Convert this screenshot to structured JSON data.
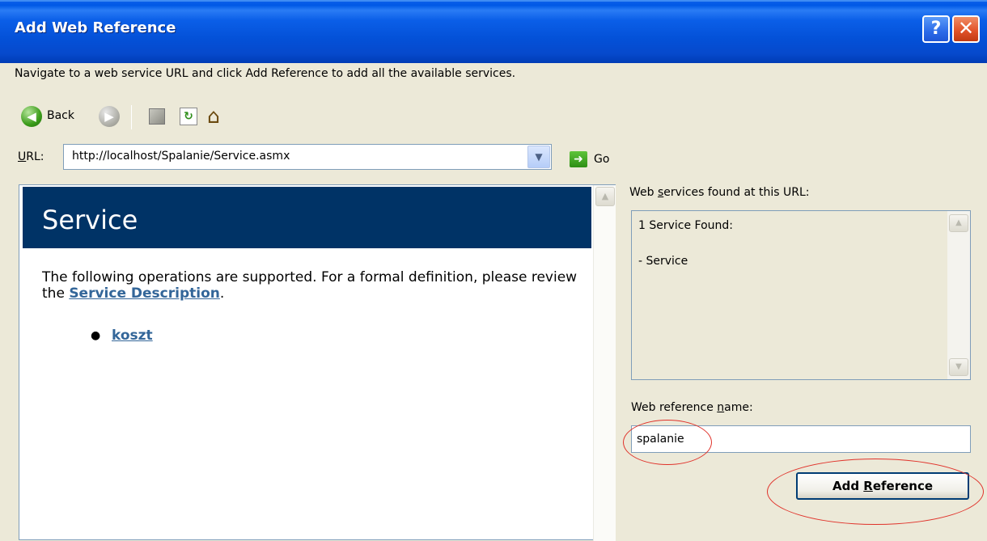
{
  "window": {
    "title": "Add Web Reference",
    "help_glyph": "?",
    "close_glyph": "✕"
  },
  "instruction": "Navigate to a web service URL and click Add Reference to add all the available services.",
  "toolbar": {
    "back_label": "Back",
    "back_icon": "back-arrow-icon",
    "forward_icon": "forward-arrow-icon",
    "stop_icon": "stop-icon",
    "refresh_icon": "refresh-icon",
    "home_icon": "home-icon"
  },
  "url": {
    "label_prefix": "",
    "label_accel": "U",
    "label_rest": "RL:",
    "value": "http://localhost/Spalanie/Service.asmx",
    "go_label": "Go"
  },
  "browser": {
    "service_title": "Service",
    "desc_before": "The following operations are supported. For a formal definition, please review the ",
    "desc_link": "Service Description",
    "desc_after": ".",
    "operations": [
      "koszt"
    ]
  },
  "found": {
    "label_before": "Web ",
    "label_accel": "s",
    "label_after": "ervices found at this URL:",
    "count_text": "1 Service Found:",
    "items": [
      "- Service"
    ]
  },
  "reference": {
    "label_before": "Web reference ",
    "label_accel": "n",
    "label_after": "ame:",
    "name_value": "spalanie",
    "button_before": "Add ",
    "button_accel": "R",
    "button_after": "eference"
  }
}
